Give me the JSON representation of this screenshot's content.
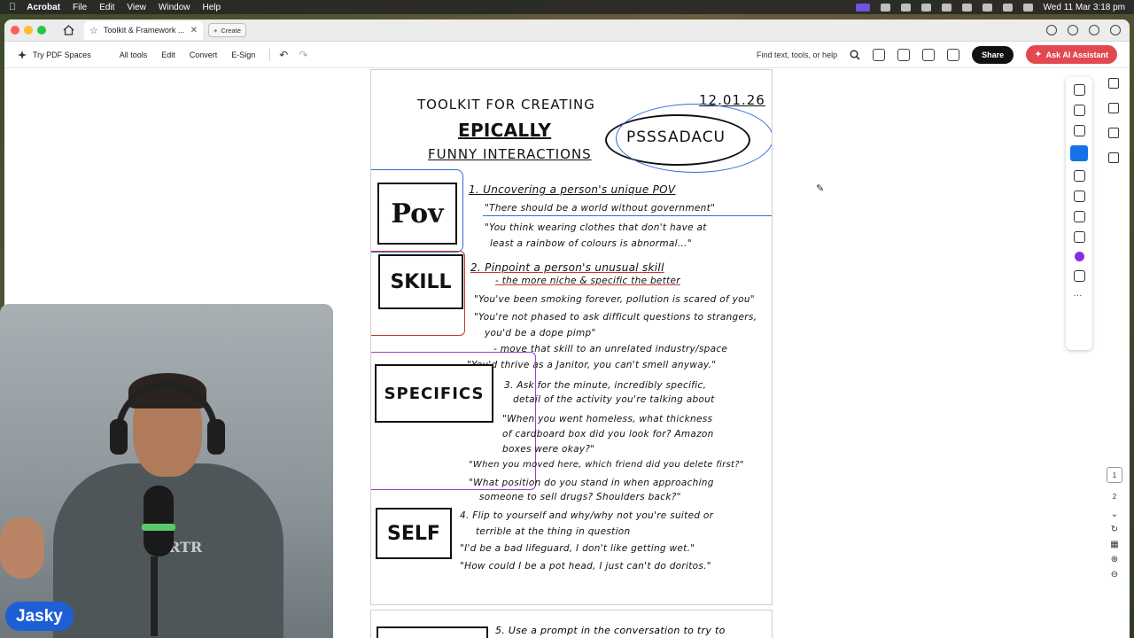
{
  "menubar": {
    "app": "Acrobat",
    "items": [
      "File",
      "Edit",
      "View",
      "Window",
      "Help"
    ],
    "clock": "Wed 11 Mar  3:18 pm"
  },
  "window": {
    "tab_title": "Toolkit & Framework ...",
    "create_label": "Create"
  },
  "toolbar": {
    "spaces": "Try PDF Spaces",
    "items": [
      "All tools",
      "Edit",
      "Convert",
      "E-Sign"
    ],
    "find": "Find text, tools, or help",
    "share": "Share",
    "ai": "Ask AI Assistant"
  },
  "document": {
    "title_line1": "TOOLKIT FOR CREATING",
    "title_line2": "EPICALLY",
    "title_line3": "FUNNY INTERACTIONS",
    "date": "12.01.26",
    "acronym": "PSSSADACU",
    "box_pov": "Pov",
    "box_skill": "SKILL",
    "box_specifics": "SPECIFICS",
    "box_self": "SELF",
    "l1": "1. Uncovering a person's unique POV",
    "l1a": "\"There should be a world without government\"",
    "l1b": "\"You think wearing clothes that don't have at",
    "l1c": "least a rainbow of colours is abnormal...\"",
    "l2": "2. Pinpoint a person's unusual skill",
    "l2a": "- the more niche & specific the better",
    "l2b": "\"You've been smoking forever, pollution is scared of you\"",
    "l2c": "\"You're not phased to ask difficult questions to strangers,",
    "l2d": "you'd be a dope pimp\"",
    "l2e": "- move that skill to an unrelated industry/space",
    "l2f": "\"You'd thrive as a Janitor, you can't smell anyway.\"",
    "l3": "3. Ask for the minute, incredibly specific,",
    "l3a": "detail of the activity you're talking about",
    "l3b": "\"When you went homeless, what thickness",
    "l3c": "of cardboard box did you look for? Amazon",
    "l3d": "boxes were okay?\"",
    "l3e": "\"When you moved here, which friend did you delete first?\"",
    "l3f": "\"What position do you stand in when approaching",
    "l3g": "someone to sell drugs? Shoulders back?\"",
    "l4": "4. Flip to yourself and why/why not you're suited or",
    "l4a": "terrible at the thing in question",
    "l4b": "\"I'd be a bad lifeguard, I don't like getting wet.\"",
    "l4c": "\"How could I be a pot head, I just can't do doritos.\"",
    "l5": "5. Use a prompt in the conversation to try to"
  },
  "pages": {
    "items": [
      "1",
      "2"
    ]
  },
  "webcam": {
    "name": "Jasky",
    "shirt_text": "RTR"
  },
  "colors": {
    "share_bg": "#111111",
    "ai_bg": "#e34850",
    "name_pill": "#1f5fd6",
    "ink_blue": "#2f6fd1",
    "ink_red": "#c0392b",
    "ink_purple": "#9b3fd1"
  }
}
